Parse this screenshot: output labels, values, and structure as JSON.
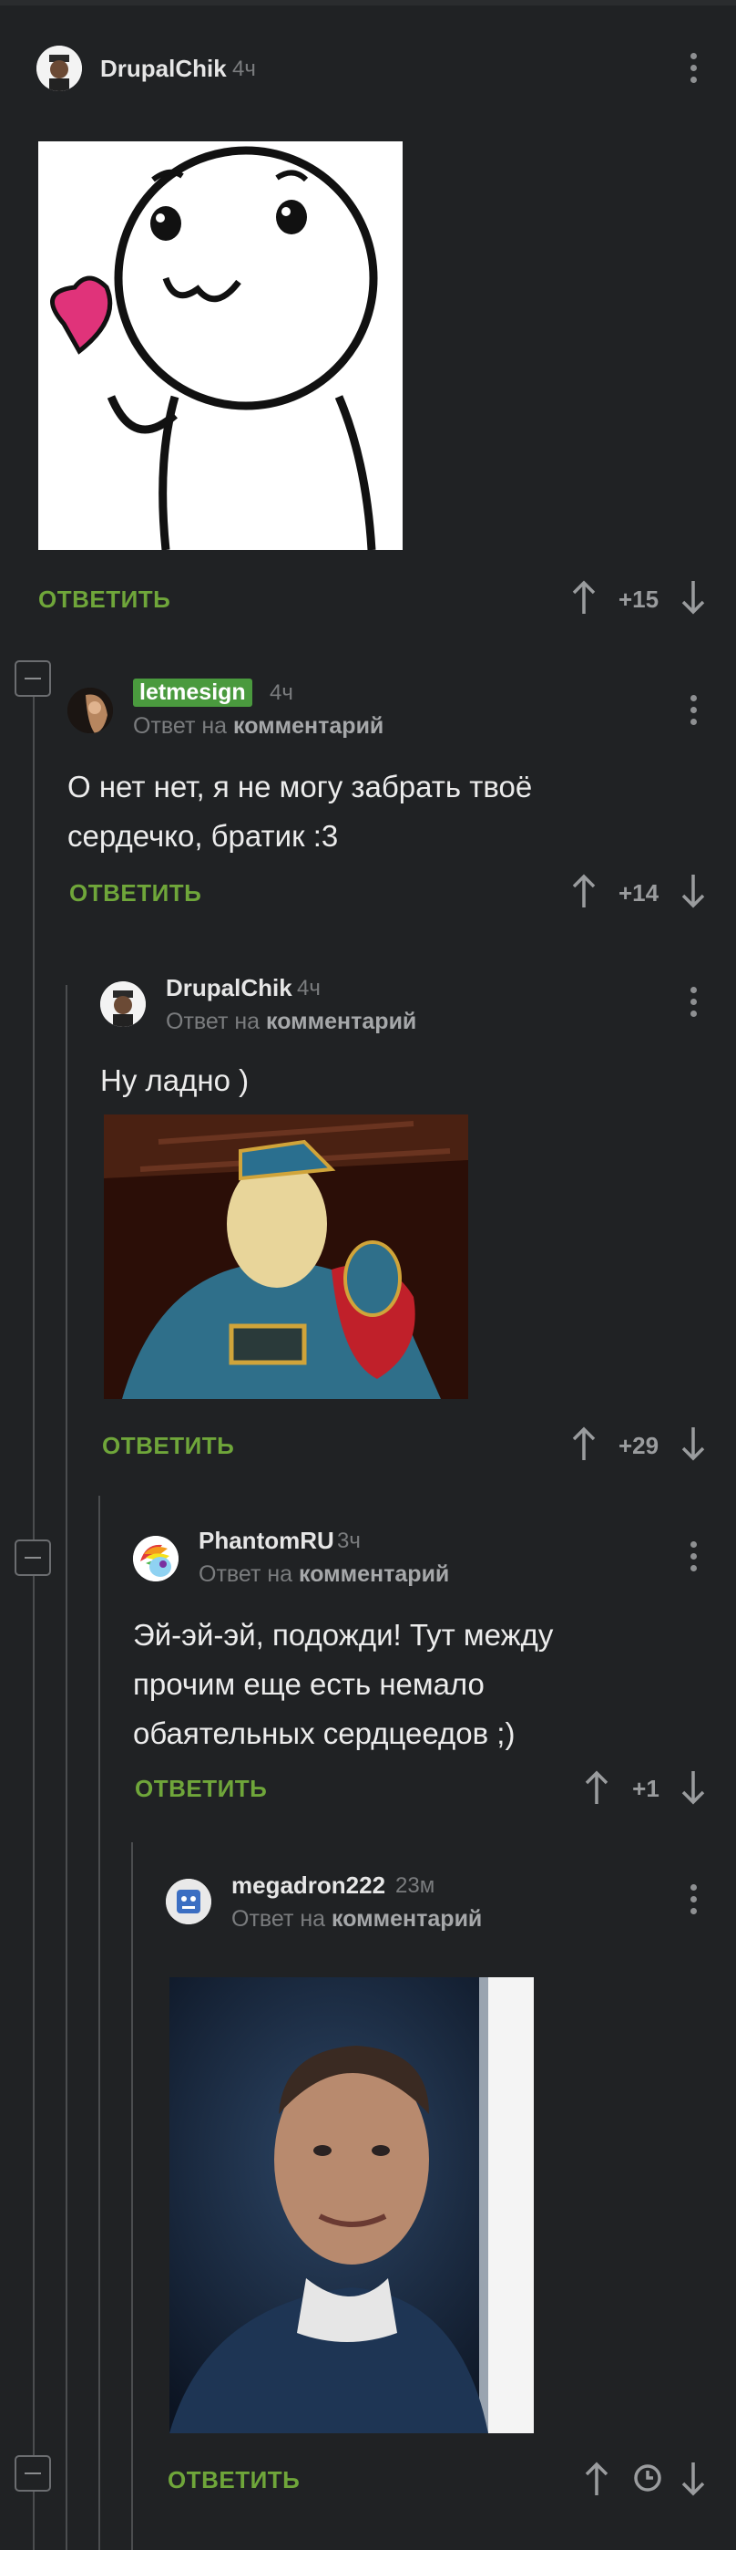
{
  "comments": [
    {
      "user": "DrupalChik",
      "time": "4ч",
      "reply_label": "ОТВЕТИТЬ",
      "rating": "+15"
    },
    {
      "user": "letmesign",
      "time": "4ч",
      "reply_to_prefix": "Ответ на",
      "reply_to_link": "комментарий",
      "text_line1": "О нет нет, я не могу забрать твоё",
      "text_line2": "сердечко, братик :3",
      "reply_label": "ОТВЕТИТЬ",
      "rating": "+14"
    },
    {
      "user": "DrupalChik",
      "time": "4ч",
      "reply_to_prefix": "Ответ на",
      "reply_to_link": "комментарий",
      "text_line1": "Ну ладно )",
      "reply_label": "ОТВЕТИТЬ",
      "rating": "+29"
    },
    {
      "user": "PhantomRU",
      "time": "3ч",
      "reply_to_prefix": "Ответ на",
      "reply_to_link": "комментарий",
      "text_line1": "Эй-эй-эй, подожди! Тут между",
      "text_line2": "прочим еще есть немало",
      "text_line3": "обаятельных сердцеедов ;)",
      "reply_label": "ОТВЕТИТЬ",
      "rating": "+1"
    },
    {
      "user": "megadron222",
      "time": "23м",
      "reply_to_prefix": "Ответ на",
      "reply_to_link": "комментарий",
      "reply_label": "ОТВЕТИТЬ"
    }
  ],
  "colors": {
    "background": "#202224",
    "accent_green": "#6fa63a",
    "badge_green": "#4a9a3e"
  }
}
